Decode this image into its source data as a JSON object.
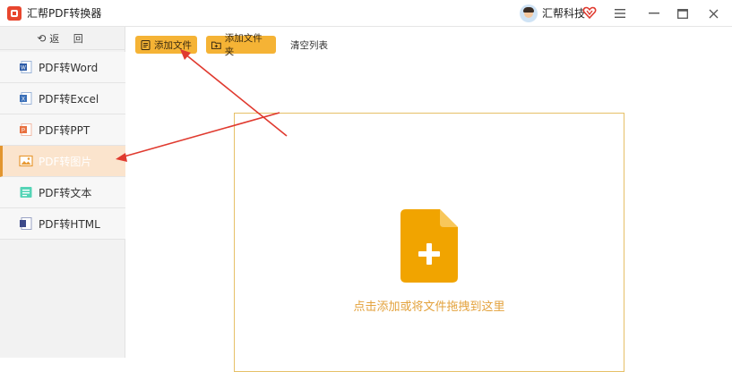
{
  "app": {
    "title": "汇帮PDF转换器",
    "user_name": "汇帮科技"
  },
  "sidebar": {
    "back_label": "返 回",
    "items": [
      {
        "label": "PDF转Word",
        "icon": "word-icon"
      },
      {
        "label": "PDF转Excel",
        "icon": "excel-icon"
      },
      {
        "label": "PDF转PPT",
        "icon": "ppt-icon"
      },
      {
        "label": "PDF转图片",
        "icon": "image-icon",
        "active": true
      },
      {
        "label": "PDF转文本",
        "icon": "text-icon"
      },
      {
        "label": "PDF转HTML",
        "icon": "html-icon"
      }
    ]
  },
  "toolbar": {
    "add_file": "添加文件",
    "add_folder": "添加文件夹",
    "clear_list": "清空列表"
  },
  "dropzone": {
    "hint": "点击添加或将文件拖拽到这里"
  },
  "colors": {
    "accent": "#f5b335",
    "active_bg": "#fbe4cd",
    "active_border": "#e2952e",
    "hint_text": "#e3a23c",
    "annotation_arrow": "#e03a2f"
  }
}
